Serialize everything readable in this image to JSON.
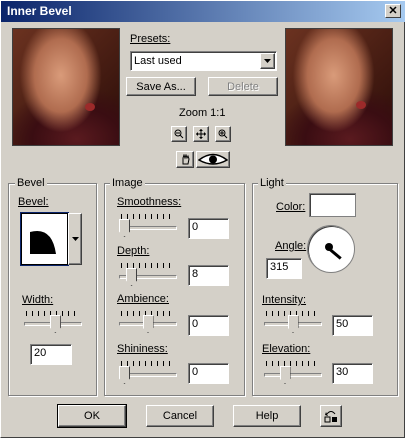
{
  "window": {
    "title": "Inner Bevel",
    "close_glyph": "✕"
  },
  "presets": {
    "label": "Presets:",
    "selected": "Last used",
    "save_as_label": "Save As...",
    "delete_label": "Delete"
  },
  "zoom": {
    "label": "Zoom 1:1"
  },
  "bevel_group": {
    "title": "Bevel",
    "bevel_label": "Bevel:",
    "width_label": "Width:",
    "width_value": "20",
    "width_level": 0.55
  },
  "image_group": {
    "title": "Image",
    "smoothness_label": "Smoothness:",
    "smoothness_value": "0",
    "smoothness_level": 0,
    "depth_label": "Depth:",
    "depth_value": "8",
    "depth_level": 0.15,
    "ambience_label": "Ambience:",
    "ambience_value": "0",
    "ambience_level": 0.5,
    "shininess_label": "Shininess:",
    "shininess_value": "0",
    "shininess_level": 0
  },
  "light_group": {
    "title": "Light",
    "color_label": "Color:",
    "color_value": "#ffffff",
    "angle_label": "Angle:",
    "angle_value": "315",
    "intensity_label": "Intensity:",
    "intensity_value": "50",
    "intensity_level": 0.5,
    "elevation_label": "Elevation:",
    "elevation_value": "30",
    "elevation_level": 0.33
  },
  "footer": {
    "ok_label": "OK",
    "cancel_label": "Cancel",
    "help_label": "Help"
  },
  "icons": {
    "zoom_out": "zoom-out-icon",
    "pan": "pan-icon",
    "zoom_in": "zoom-in-icon",
    "hand": "hand-icon",
    "eye": "eye-icon",
    "reset": "reset-icon"
  }
}
